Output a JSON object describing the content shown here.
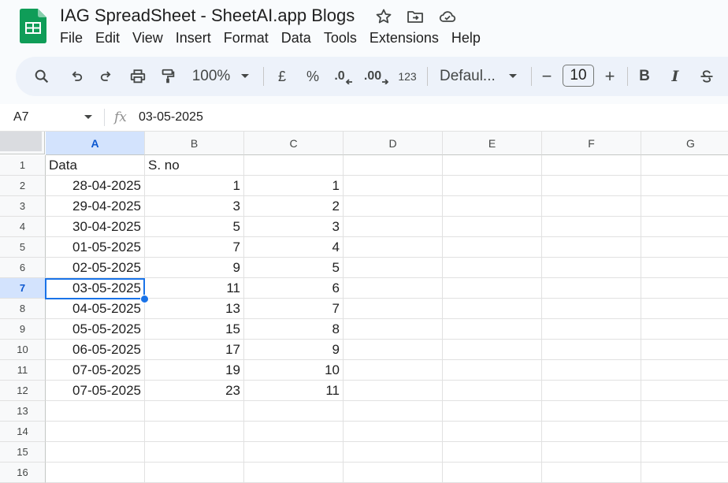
{
  "doc": {
    "title": "IAG SpreadSheet - SheetAI.app Blogs",
    "icons": [
      "sheets-logo",
      "star-icon",
      "move-to-folder-icon",
      "cloud-saved-icon"
    ]
  },
  "menu": [
    "File",
    "Edit",
    "View",
    "Insert",
    "Format",
    "Data",
    "Tools",
    "Extensions",
    "Help"
  ],
  "toolbar": {
    "zoom": "100%",
    "currency": "£",
    "percent": "%",
    "decrease_decimal": ".0",
    "increase_decimal": ".00",
    "more_formats": "123",
    "font": "Defaul...",
    "font_size": "10",
    "minus": "−",
    "plus": "+",
    "bold": "B",
    "italic": "I"
  },
  "formula_bar": {
    "name_box": "A7",
    "fx": "fx",
    "value": "03-05-2025"
  },
  "columns": [
    "A",
    "B",
    "C",
    "D",
    "E",
    "F",
    "G"
  ],
  "row_numbers": [
    "1",
    "2",
    "3",
    "4",
    "5",
    "6",
    "7",
    "8",
    "9",
    "10",
    "11",
    "12",
    "13",
    "14",
    "15",
    "16"
  ],
  "selected": {
    "row": "7",
    "column": "A"
  },
  "rows": [
    [
      "Data",
      "S. no",
      ""
    ],
    [
      "28-04-2025",
      "1",
      "1"
    ],
    [
      "29-04-2025",
      "3",
      "2"
    ],
    [
      "30-04-2025",
      "5",
      "3"
    ],
    [
      "01-05-2025",
      "7",
      "4"
    ],
    [
      "02-05-2025",
      "9",
      "5"
    ],
    [
      "03-05-2025",
      "11",
      "6"
    ],
    [
      "04-05-2025",
      "13",
      "7"
    ],
    [
      "05-05-2025",
      "15",
      "8"
    ],
    [
      "06-05-2025",
      "17",
      "9"
    ],
    [
      "07-05-2025",
      "19",
      "10"
    ],
    [
      "07-05-2025",
      "23",
      "11"
    ]
  ],
  "colors": {
    "accent": "#1a73e8",
    "sheets_green": "#0f9d58",
    "selected_header": "#d3e3fd"
  }
}
